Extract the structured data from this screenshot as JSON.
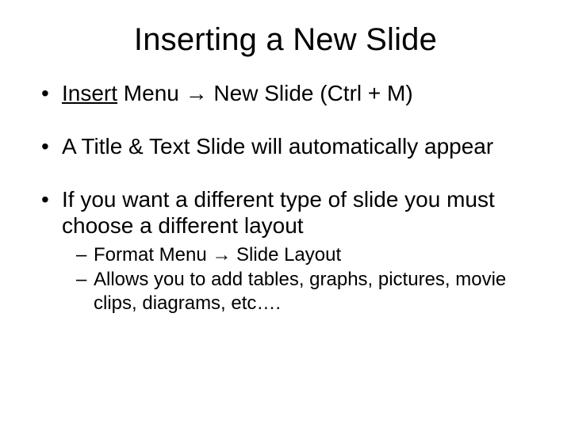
{
  "title": "Inserting a New Slide",
  "bullets": {
    "b1_underlined": "Insert",
    "b1_rest": " Menu → New Slide (Ctrl + M)",
    "b2": "A Title & Text Slide will automatically appear",
    "b3": "If you want a different type of slide you must choose a different layout",
    "sub": {
      "s1": "Format Menu → Slide Layout",
      "s2": "Allows you to add tables, graphs, pictures, movie clips, diagrams, etc…."
    }
  }
}
